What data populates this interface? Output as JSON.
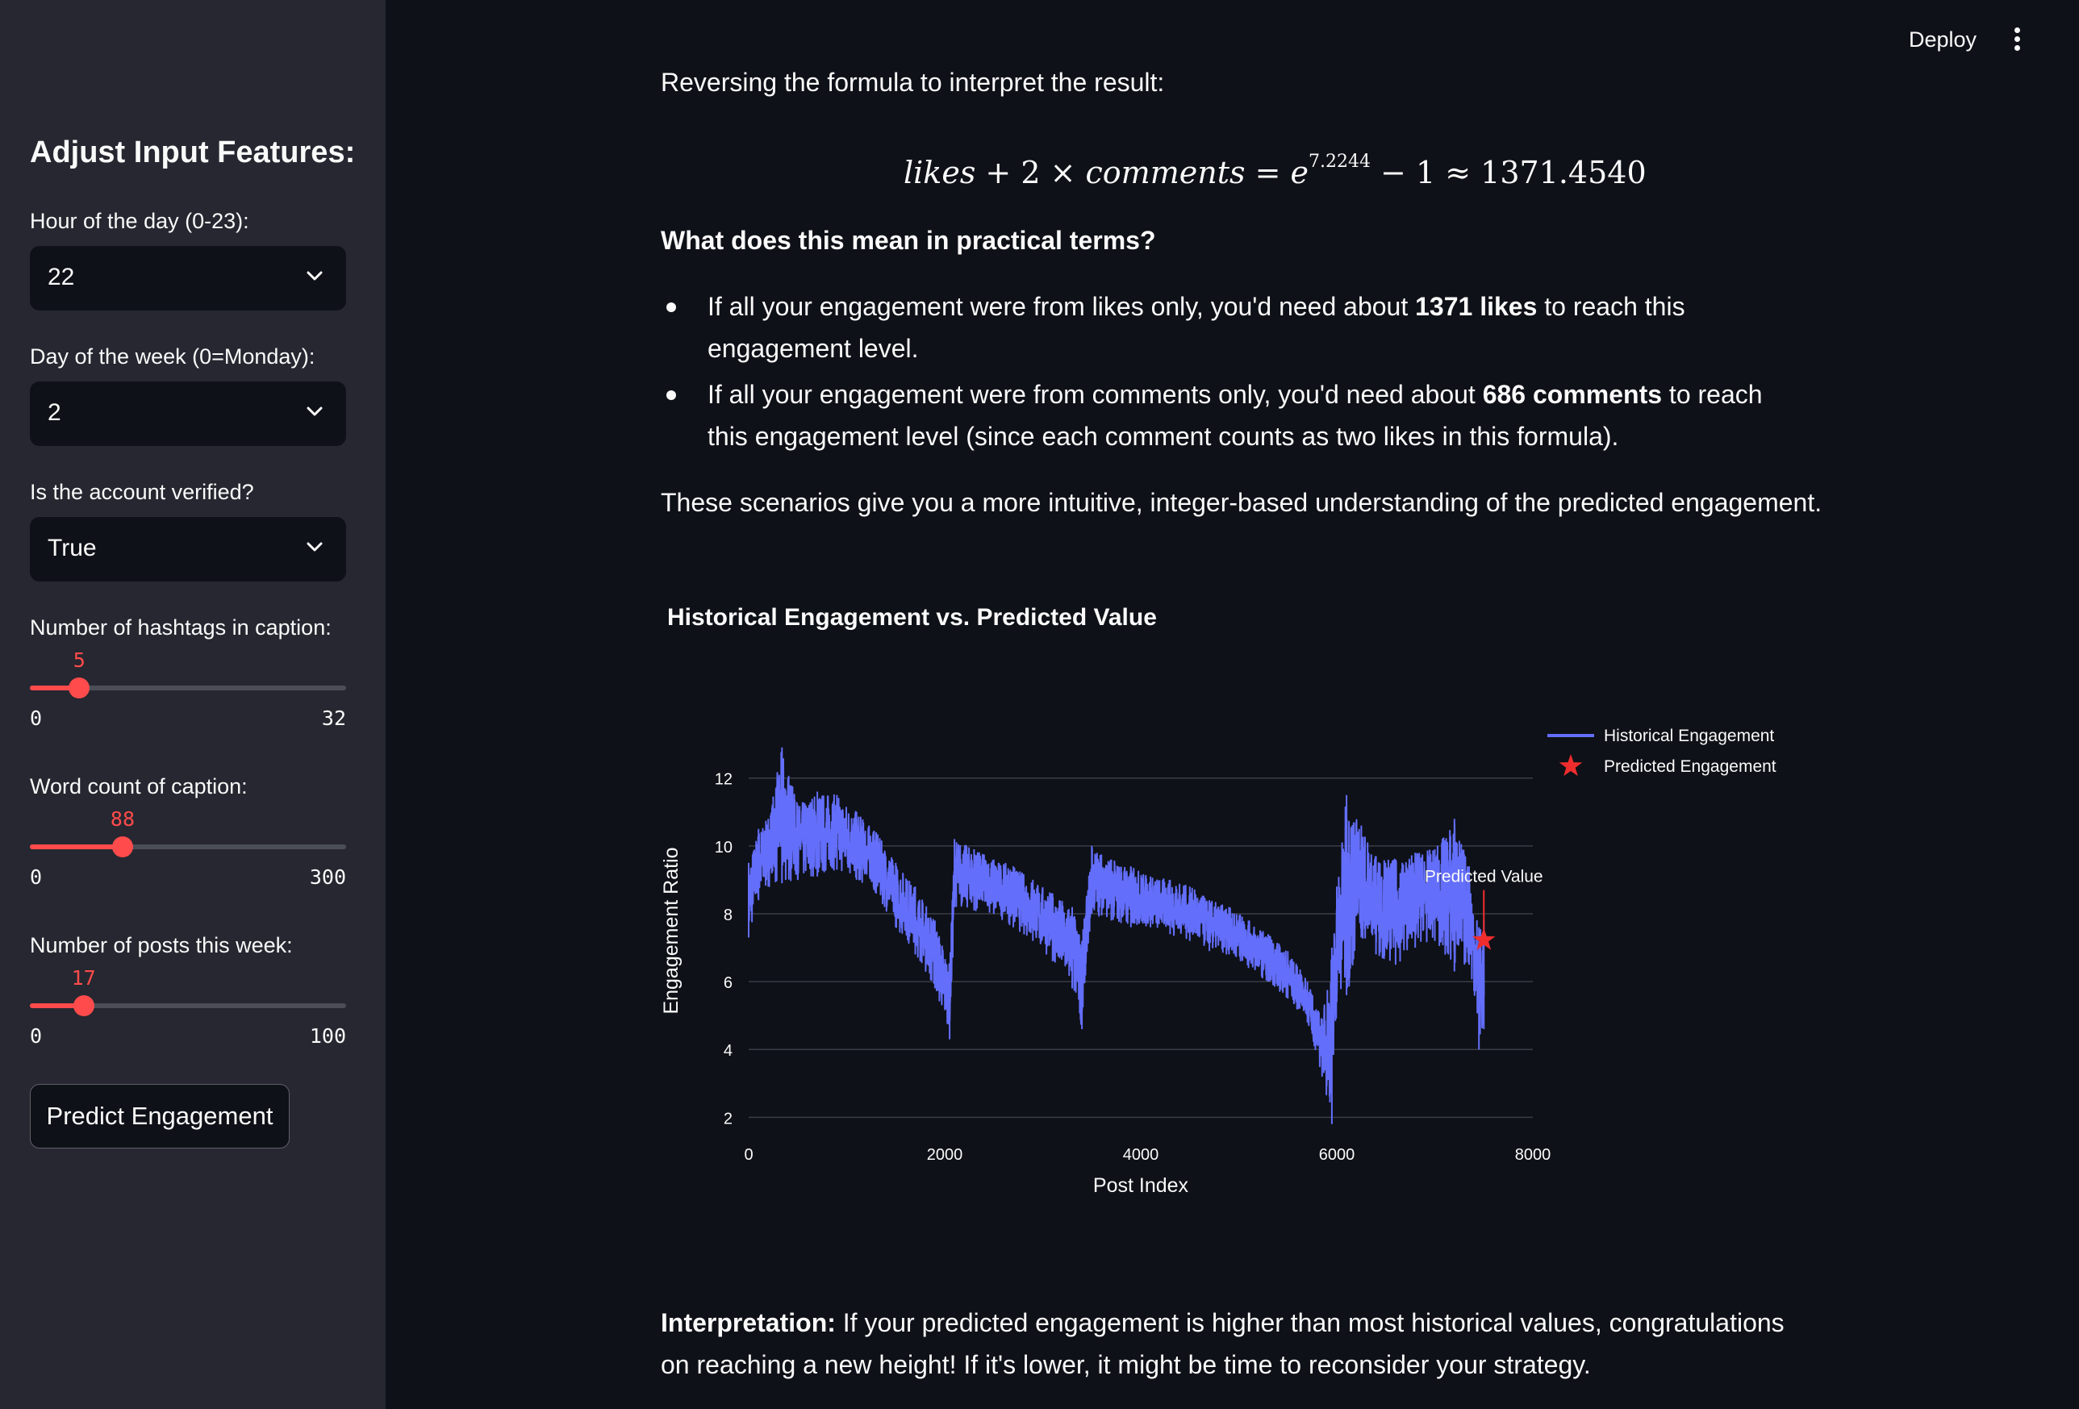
{
  "header": {
    "deploy_label": "Deploy",
    "menu_icon": "kebab-menu-icon"
  },
  "sidebar": {
    "title": "Adjust Input Features:",
    "hour": {
      "label": "Hour of the day (0-23):",
      "value": "22"
    },
    "day": {
      "label": "Day of the week (0=Monday):",
      "value": "2"
    },
    "verified": {
      "label": "Is the account verified?",
      "value": "True"
    },
    "hashtags": {
      "label": "Number of hashtags in caption:",
      "value": 5,
      "value_text": "5",
      "min": "0",
      "max": "32",
      "min_num": 0,
      "max_num": 32
    },
    "words": {
      "label": "Word count of caption:",
      "value": 88,
      "value_text": "88",
      "min": "0",
      "max": "300",
      "min_num": 0,
      "max_num": 300
    },
    "posts": {
      "label": "Number of posts this week:",
      "value": 17,
      "value_text": "17",
      "min": "0",
      "max": "100",
      "min_num": 0,
      "max_num": 100
    },
    "predict_button": "Predict Engagement"
  },
  "main": {
    "top_text": "Reversing the formula to interpret the result:",
    "formula": {
      "lhs_a": "likes",
      "plus": " + 2 × ",
      "lhs_b": "comments",
      "eq": " = ",
      "e": "e",
      "exp": "7.2244",
      "rhs": " − 1 ≈ 1371.4540"
    },
    "practical_heading": "What does this mean in practical terms?",
    "bullet1": {
      "pre": "If all your engagement were from likes only, you'd need about ",
      "bold": "1371 likes",
      "post": " to reach this engagement level."
    },
    "bullet2": {
      "pre": "If all your engagement were from comments only, you'd need about ",
      "bold": "686 comments",
      "post": " to reach this engagement level (since each comment counts as two likes in this formula)."
    },
    "scenarios_text": "These scenarios give you a more intuitive, integer-based understanding of the predicted engagement.",
    "chart_heading": "Historical Engagement vs. Predicted Value",
    "interpretation_label": "Interpretation:",
    "interpretation_text": " If your predicted engagement is higher than most historical values, congratulations on reaching a new height! If it's lower, it might be time to reconsider your strategy."
  },
  "chart_data": {
    "type": "line",
    "xlabel": "Post Index",
    "ylabel": "Engagement Ratio",
    "xlim": [
      0,
      8000
    ],
    "ylim": [
      1.7,
      13.3
    ],
    "xticks": [
      0,
      2000,
      4000,
      6000,
      8000
    ],
    "yticks": [
      2,
      4,
      6,
      8,
      10,
      12
    ],
    "xtick_labels": [
      "0",
      "2000",
      "4000",
      "6000",
      "8000"
    ],
    "ytick_labels": [
      "2",
      "4",
      "6",
      "8",
      "10",
      "12"
    ],
    "grid": "horizontal",
    "legend_position": "top-right",
    "series": [
      {
        "name": "Historical Engagement",
        "color": "#636efa",
        "envelope_x": [
          0,
          100,
          200,
          340,
          500,
          700,
          900,
          1100,
          1300,
          1500,
          1700,
          1900,
          2050,
          2100,
          2300,
          2500,
          2700,
          2900,
          3100,
          3300,
          3400,
          3500,
          3700,
          3900,
          4100,
          4300,
          4500,
          4700,
          4900,
          5100,
          5300,
          5500,
          5700,
          5850,
          5950,
          6000,
          6100,
          6250,
          6400,
          6600,
          6800,
          7000,
          7200,
          7350,
          7450,
          7500
        ],
        "envelope_low": [
          7.3,
          8.4,
          8.8,
          8.9,
          9.0,
          9.1,
          9.3,
          9.0,
          8.6,
          7.6,
          6.8,
          5.8,
          4.3,
          8.2,
          8.1,
          8.0,
          7.6,
          7.2,
          6.6,
          5.8,
          4.6,
          8.0,
          7.8,
          7.6,
          7.6,
          7.4,
          7.2,
          6.9,
          6.8,
          6.4,
          6.0,
          5.5,
          4.8,
          3.2,
          1.8,
          5.4,
          5.6,
          7.3,
          6.8,
          6.5,
          7.0,
          7.2,
          6.3,
          6.5,
          4.0,
          4.6
        ],
        "envelope_high": [
          9.5,
          10.5,
          10.8,
          12.9,
          11.2,
          11.6,
          11.5,
          11.0,
          10.4,
          9.5,
          8.8,
          7.8,
          6.5,
          10.2,
          9.9,
          9.6,
          9.4,
          9.0,
          8.6,
          8.2,
          7.2,
          10.0,
          9.6,
          9.4,
          9.1,
          9.0,
          8.8,
          8.4,
          8.2,
          7.8,
          7.4,
          6.9,
          6.0,
          4.9,
          7.0,
          8.8,
          11.5,
          10.6,
          9.7,
          9.6,
          9.8,
          9.9,
          10.8,
          9.4,
          7.6,
          7.8
        ]
      },
      {
        "name": "Predicted Engagement",
        "color": "#ef2d2d",
        "marker": "star",
        "x": [
          7500
        ],
        "y": [
          7.2244
        ]
      }
    ],
    "annotations": [
      {
        "text": "Predicted Value",
        "x": 7500,
        "y": 7.2244
      }
    ]
  }
}
